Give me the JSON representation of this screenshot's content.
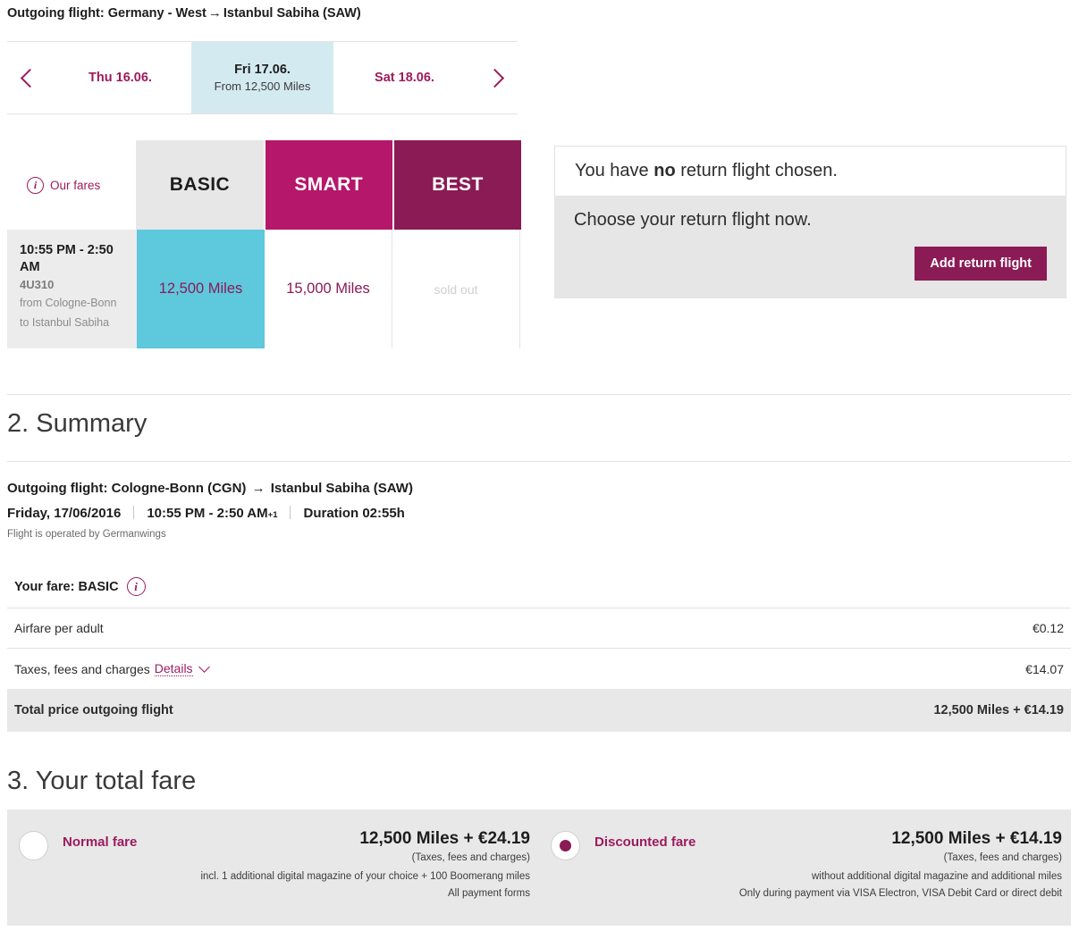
{
  "header": {
    "title_prefix": "Outgoing flight: Germany - West",
    "arrow": "→",
    "title_dest": "Istanbul Sabiha (SAW)"
  },
  "date_selector": {
    "prev_icon": "chevron-left-icon",
    "next_icon": "chevron-right-icon",
    "days": [
      {
        "label": "Thu 16.06.",
        "sub": "",
        "active": false
      },
      {
        "label": "Fri 17.06.",
        "sub": "From 12,500 Miles",
        "active": true
      },
      {
        "label": "Sat 18.06.",
        "sub": "",
        "active": false
      }
    ]
  },
  "fare_matrix": {
    "our_fares_label": "Our fares",
    "info_icon": "info-icon",
    "columns": [
      "BASIC",
      "SMART",
      "BEST"
    ],
    "flight": {
      "time": "10:55 PM - 2:50 AM",
      "number": "4U310",
      "from": "from Cologne-Bonn",
      "to": "to Istanbul Sabiha"
    },
    "cells": [
      {
        "value": "12,500 Miles",
        "state": "selected"
      },
      {
        "value": "15,000 Miles",
        "state": "available"
      },
      {
        "value": "sold out",
        "state": "soldout"
      }
    ]
  },
  "return_panel": {
    "status_prefix": "You have ",
    "status_bold": "no",
    "status_suffix": " return flight chosen.",
    "prompt": "Choose your return flight now.",
    "button_label": "Add return flight"
  },
  "summary": {
    "section_title": "2. Summary",
    "route_label": "Outgoing flight: Cologne-Bonn (CGN)",
    "route_arrow": "→",
    "route_dest": "Istanbul Sabiha (SAW)",
    "date": "Friday, 17/06/2016",
    "times": "10:55 PM - 2:50 AM",
    "times_sup": "+1",
    "duration": "Duration 02:55h",
    "operator": "Flight is operated by Germanwings",
    "your_fare_label": "Your fare: BASIC",
    "your_fare_info_icon": "info-icon",
    "rows": [
      {
        "label": "Airfare per adult",
        "value": "€0.12"
      },
      {
        "label": "Taxes, fees and charges",
        "link": "Details",
        "value": "€14.07"
      }
    ],
    "total": {
      "label": "Total price outgoing flight",
      "value": "12,500 Miles + €14.19"
    }
  },
  "total_fare": {
    "section_title": "3. Your total fare",
    "options": [
      {
        "name": "Normal fare",
        "selected": false,
        "price": "12,500 Miles + €24.19",
        "note": "(Taxes, fees and charges)",
        "note2": "incl. 1 additional digital magazine of your choice + 100 Boomerang miles",
        "note3": "All payment forms"
      },
      {
        "name": "Discounted fare",
        "selected": true,
        "price": "12,500 Miles + €14.19",
        "note": "(Taxes, fees and charges)",
        "note2": "without additional digital magazine and additional miles",
        "note3": "Only during payment via VISA Electron, VISA Debit Card or direct debit"
      }
    ]
  },
  "colors": {
    "brand_magenta": "#9c1b5e",
    "smart_magenta": "#b5176a",
    "best_dark": "#8a1b55",
    "selected_cyan": "#5ec8dd",
    "active_day_blue": "#d4eaf1",
    "panel_gray": "#e6e6e6"
  }
}
